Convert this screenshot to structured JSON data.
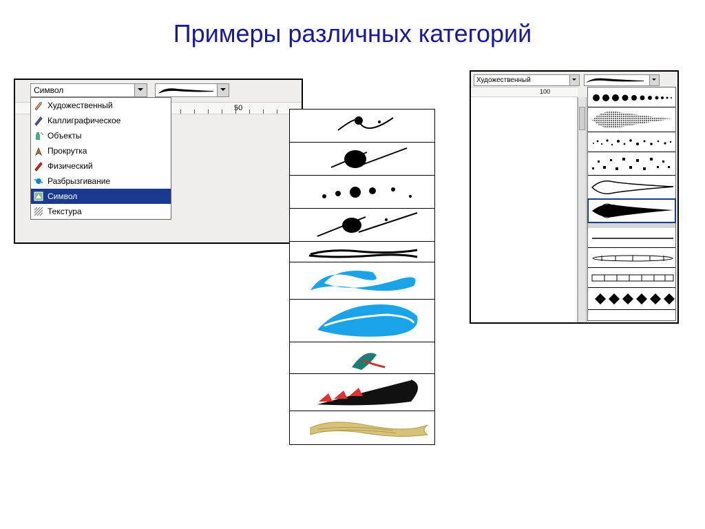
{
  "title": "Примеры различных категорий",
  "left": {
    "combo_value": "Символ",
    "ruler_mark": "50",
    "menu": [
      {
        "label": "Художественный",
        "icon": "brush"
      },
      {
        "label": "Каллиграфическое",
        "icon": "pen"
      },
      {
        "label": "Объекты",
        "icon": "spray"
      },
      {
        "label": "Прокрутка",
        "icon": "nib"
      },
      {
        "label": "Физический",
        "icon": "pencil"
      },
      {
        "label": "Разбрызгивание",
        "icon": "splat"
      },
      {
        "label": "Символ",
        "icon": "symbol",
        "selected": true
      },
      {
        "label": "Текстура",
        "icon": "hatch"
      }
    ]
  },
  "right": {
    "combo_value": "Художественный",
    "ruler_mark": "100"
  }
}
